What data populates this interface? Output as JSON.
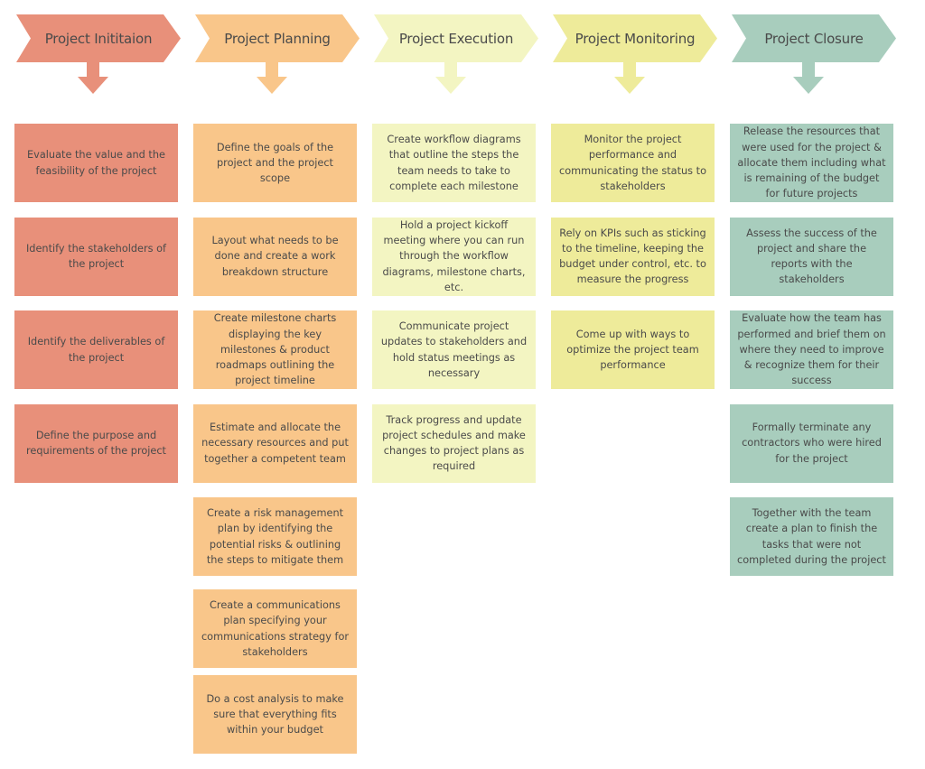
{
  "diagram": {
    "phases": [
      {
        "title": "Project Inititaion",
        "color": "#e8907a",
        "tasks": [
          "Evaluate the value and the feasibility of the project",
          "Identify the stakeholders of the project",
          "Identify the deliverables of the project",
          "Define the purpose and requirements of the project"
        ]
      },
      {
        "title": "Project Planning",
        "color": "#f9c68a",
        "tasks": [
          "Define the goals of the project and the project scope",
          "Layout what needs to be done and create a work breakdown structure",
          "Create milestone charts displaying the key milestones & product roadmaps outlining the project timeline",
          "Estimate and allocate the necessary resources and put together a competent team",
          "Create a risk management plan by identifying the potential risks & outlining the steps to mitigate them",
          "Create a communications plan specifying your communications strategy for stakeholders",
          "Do a cost analysis to make sure that everything fits within your budget"
        ]
      },
      {
        "title": "Project Execution",
        "color": "#f3f5c2",
        "tasks": [
          "Create workflow diagrams that outline the steps the team needs to take to complete each milestone",
          "Hold a project kickoff meeting where you can run through the workflow diagrams, milestone charts, etc.",
          "Communicate project updates to stakeholders and hold status meetings as necessary",
          "Track progress and update project schedules and make changes to project plans as required"
        ]
      },
      {
        "title": "Project Monitoring",
        "color": "#eeeb9a",
        "tasks": [
          "Monitor the project performance and communicating the status to stakeholders",
          "Rely on KPIs such as sticking to the timeline, keeping the budget under control, etc. to measure the progress",
          "Come up with ways to optimize the project team performance"
        ]
      },
      {
        "title": "Project Closure",
        "color": "#a8cdbd",
        "tasks": [
          "Release the resources that were used for the project & allocate them including what is remaining of the budget for future projects",
          "Assess the success of the project and share the reports with the stakeholders",
          "Evaluate how the team has performed and brief them on where they need to improve & recognize them for their success",
          "Formally terminate any contractors who were hired for the project",
          "Together with the team create a plan to finish the tasks that were not completed during the project"
        ]
      }
    ]
  }
}
